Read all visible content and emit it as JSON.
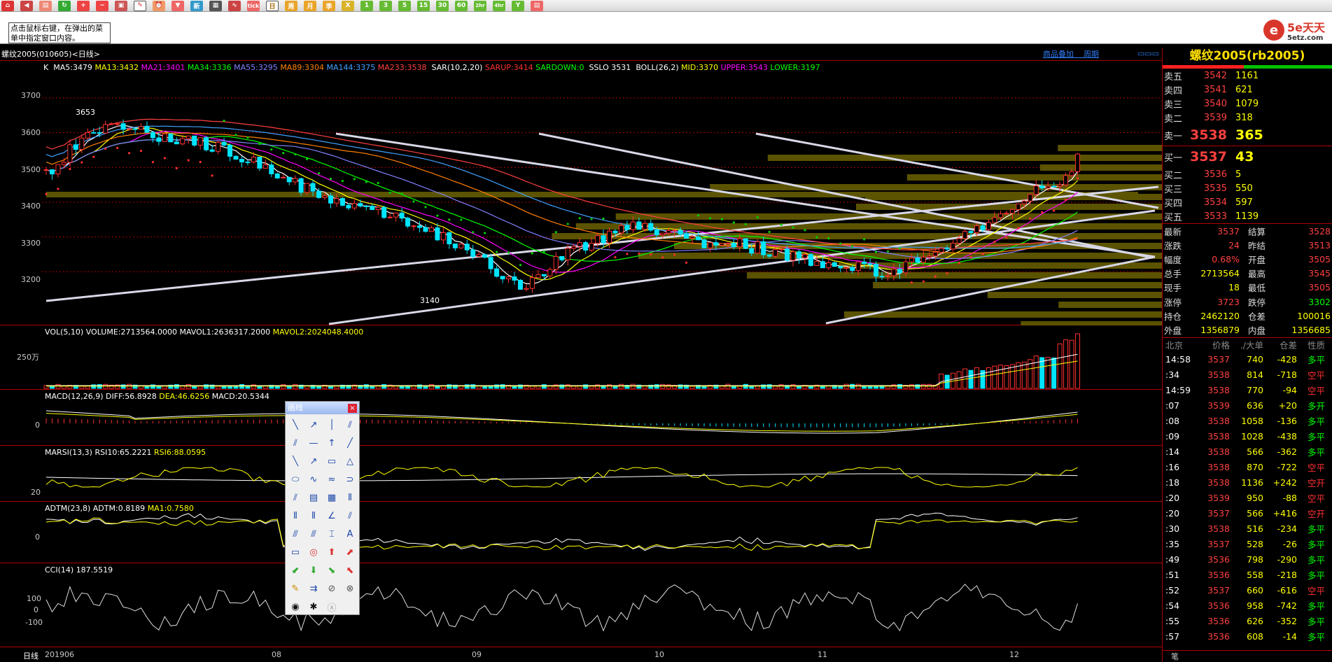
{
  "toolbar": {
    "icons": [
      "home-icon",
      "back-icon",
      "news-icon",
      "refresh-icon",
      "zoom-in-icon",
      "zoom-out-icon",
      "window-icon",
      "draw-icon",
      "alarm-icon",
      "filter-icon",
      "new-icon",
      "table-icon",
      "chart-icon",
      "tick-icon",
      "day-icon",
      "week-icon",
      "month-icon",
      "season-icon",
      "x-icon",
      "one-min-icon",
      "three-min-icon",
      "five-min-icon",
      "fifteen-min-icon",
      "thirty-min-icon",
      "sixty-min-icon",
      "two-hour-icon",
      "four-hour-icon",
      "year-icon",
      "calc-icon"
    ],
    "labels": {
      "tick": "tick",
      "day": "日",
      "week": "周",
      "month": "月",
      "season": "季",
      "x": "X",
      "m1": "1",
      "m3": "3",
      "m5": "5",
      "m15": "15",
      "m30": "30",
      "m60": "60",
      "h2": "2hr",
      "h4": "4hr",
      "year": "Y"
    }
  },
  "tip": "点击鼠标右键，在弹出的菜单中指定窗口内容。",
  "logo": {
    "brand": "5e天天",
    "site": "5etz.com"
  },
  "title": {
    "text": "螺纹2005(010605)<日线>",
    "link1": "商品叠加",
    "link2": "周期"
  },
  "main_indicator": {
    "k": "K",
    "ma5": "MA5:3479",
    "ma13": "MA13:3432",
    "ma21": "MA21:3401",
    "ma34": "MA34:3336",
    "ma55": "MA55:3295",
    "ma89": "MA89:3304",
    "ma144": "MA144:3375",
    "ma233": "MA233:3538",
    "sar": "SAR(10,2,20)",
    "sarup": "SARUP:3414",
    "sardown": "SARDOWN:0",
    "sslo": "SSLO 3531",
    "boll": "BOLL(26,2)",
    "mid": "MID:3370",
    "upper": "UPPER:3543",
    "lower": "LOWER:3197"
  },
  "price_axis": [
    "3700",
    "3600",
    "3500",
    "3400",
    "3300",
    "3200"
  ],
  "price_marks": {
    "high": "3653",
    "low": "3140"
  },
  "vol": {
    "name": "VOL(5,10)",
    "volume": "VOLUME:2713564.0000",
    "mavol1": "MAVOL1:2636317.2000",
    "mavol2": "MAVOL2:2024048.4000",
    "axis": "250万"
  },
  "macd": {
    "name": "MACD(12,26,9)",
    "diff": "DIFF:56.8928",
    "dea": "DEA:46.6256",
    "macd": "MACD:20.5344",
    "axis": "0"
  },
  "marsi": {
    "name": "MARSI(13,3)",
    "rsi10": "RSI10:65.2221",
    "rsi6": "RSI6:88.0595",
    "axis": "20"
  },
  "adtm": {
    "name": "ADTM(23,8)",
    "adtm": "ADTM:0.8189",
    "ma1": "MA1:0.7580",
    "axis": "0"
  },
  "cci": {
    "name": "CCI(14)",
    "value": "187.5519",
    "axis": [
      "100",
      "0",
      "-100"
    ]
  },
  "date_axis": {
    "label": "日线",
    "dates": [
      "201906",
      "08",
      "09",
      "10",
      "11",
      "12"
    ]
  },
  "draw_panel": {
    "title": "画线",
    "close": "×",
    "icons": [
      "line-segment-icon",
      "ray-icon",
      "vertical-ray-icon",
      "parallel-icon",
      "parallel-channel-icon",
      "horizontal-line-icon",
      "vertical-line-icon",
      "trend-line-icon",
      "diagonal-icon",
      "arrow-line-icon",
      "rectangle-icon",
      "triangle-icon",
      "ellipse-icon",
      "sine-icon",
      "wave-icon",
      "arc-icon",
      "fibonacci-fan-icon",
      "fibonacci-icon",
      "gann-icon",
      "cycle-icon",
      "time-zone-icon",
      "percent-icon",
      "angle-icon",
      "fan-icon",
      "channel-icon",
      "andrew-icon",
      "regression-icon",
      "text-icon",
      "ruler-icon",
      "target-icon",
      "up-arrow-icon",
      "up-right-arrow-icon",
      "down-left-arrow-icon",
      "down-arrow-icon",
      "down-right-arrow-icon",
      "up-left-arrow-icon",
      "highlighter-icon",
      "price-label-icon",
      "hide-icon",
      "show-icon",
      "eye-icon",
      "settings-icon",
      "delete-icon"
    ]
  },
  "quote": {
    "title": "螺纹2005(rb2005)",
    "asks": [
      [
        "卖五",
        "3542",
        "1161"
      ],
      [
        "卖四",
        "3541",
        "621"
      ],
      [
        "卖三",
        "3540",
        "1079"
      ],
      [
        "卖二",
        "3539",
        "318"
      ],
      [
        "卖一",
        "3538",
        "365"
      ]
    ],
    "bids": [
      [
        "买一",
        "3537",
        "43"
      ],
      [
        "买二",
        "3536",
        "5"
      ],
      [
        "买三",
        "3535",
        "550"
      ],
      [
        "买四",
        "3534",
        "597"
      ],
      [
        "买五",
        "3533",
        "1139"
      ]
    ],
    "stats": [
      [
        "最新",
        "3537",
        "结算",
        "3528"
      ],
      [
        "涨跌",
        "24",
        "昨结",
        "3513"
      ],
      [
        "幅度",
        "0.68%",
        "开盘",
        "3505"
      ],
      [
        "总手",
        "2713564",
        "最高",
        "3545"
      ],
      [
        "现手",
        "18",
        "最低",
        "3505"
      ],
      [
        "涨停",
        "3723",
        "跌停",
        "3302"
      ],
      [
        "持仓",
        "2462120",
        "仓差",
        "100016"
      ],
      [
        "外盘",
        "1356879",
        "内盘",
        "1356685"
      ]
    ],
    "trade_header": [
      "北京",
      "价格",
      "./大单",
      "仓差",
      "性质"
    ],
    "trades": [
      [
        "14:58",
        "3537",
        "740",
        "-428",
        "多平"
      ],
      [
        ":34",
        "3538",
        "814",
        "-718",
        "空平"
      ],
      [
        "14:59",
        "3538",
        "770",
        "-94",
        "空平"
      ],
      [
        ":07",
        "3539",
        "636",
        "+20",
        "多开"
      ],
      [
        ":08",
        "3538",
        "1058",
        "-136",
        "多平"
      ],
      [
        ":09",
        "3538",
        "1028",
        "-438",
        "多平"
      ],
      [
        ":14",
        "3538",
        "566",
        "-362",
        "多平"
      ],
      [
        ":16",
        "3538",
        "870",
        "-722",
        "空平"
      ],
      [
        ":18",
        "3538",
        "1136",
        "+242",
        "空开"
      ],
      [
        ":20",
        "3539",
        "950",
        "-88",
        "空平"
      ],
      [
        ":20",
        "3537",
        "566",
        "+416",
        "空开"
      ],
      [
        ":30",
        "3538",
        "516",
        "-234",
        "多平"
      ],
      [
        ":35",
        "3537",
        "528",
        "-26",
        "多平"
      ],
      [
        ":49",
        "3536",
        "798",
        "-290",
        "多平"
      ],
      [
        ":51",
        "3536",
        "558",
        "-218",
        "多平"
      ],
      [
        ":52",
        "3537",
        "660",
        "-616",
        "空平"
      ],
      [
        ":54",
        "3536",
        "958",
        "-742",
        "多平"
      ],
      [
        ":55",
        "3536",
        "626",
        "-352",
        "多平"
      ],
      [
        ":57",
        "3536",
        "608",
        "-14",
        "多平"
      ]
    ],
    "footer": "笔"
  },
  "colors": {
    "up": "#ff3030",
    "down": "#00e5ff",
    "ma5": "#ffffff",
    "ma13": "#ffff00",
    "ma21": "#ff00ff",
    "ma34": "#00ff00",
    "ma55": "#8080ff",
    "ma89": "#ff8000",
    "ma144": "#40a0ff",
    "ma233": "#ff4040",
    "grid": "#b00000"
  }
}
